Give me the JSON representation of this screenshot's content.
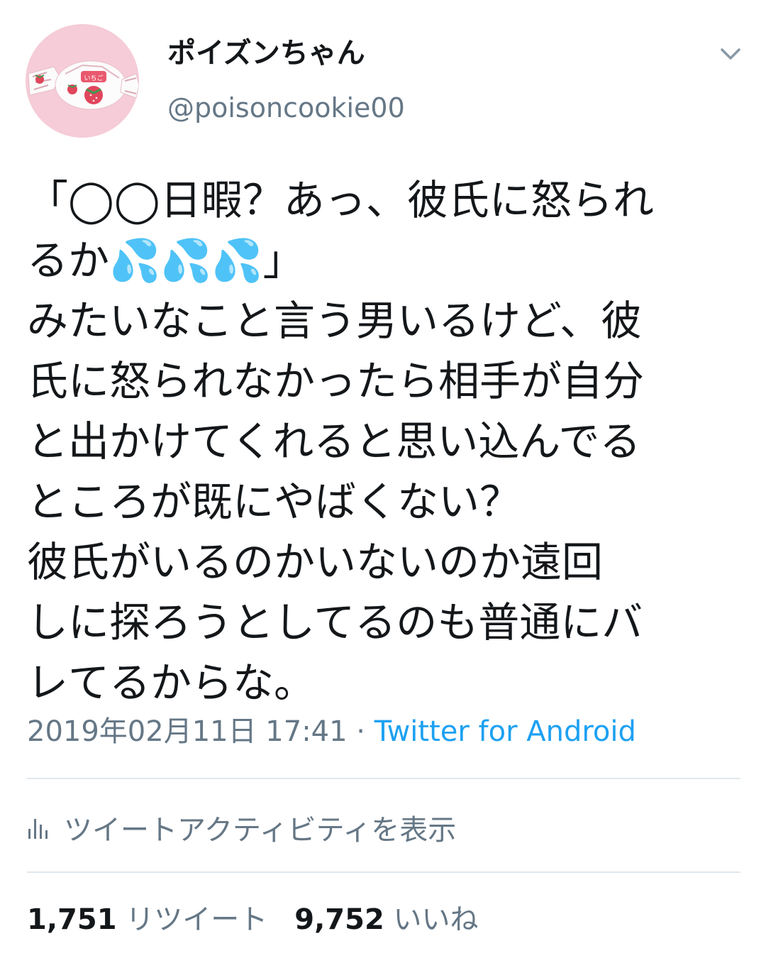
{
  "user": {
    "display_name": "ポイズンちゃん",
    "handle": "@poisoncookie00"
  },
  "tweet": {
    "lines": [
      "「◯◯日暇？あっ、彼氏に怒られ",
      "るか💦💦💦」",
      "みたいなこと言う男いるけど、彼",
      "氏に怒られなかったら相手が自分",
      "と出かけてくれると思い込んでる",
      "ところが既にやばくない？",
      "彼氏がいるのかいないのか遠回",
      "しに探ろうとしてるのも普通にバ",
      "レてるからな。"
    ]
  },
  "meta": {
    "timestamp": "2019年02月11日 17:41",
    "separator": " · ",
    "source": "Twitter for Android"
  },
  "activity": {
    "label": "ツイートアクティビティを表示"
  },
  "stats": {
    "retweet_count": "1,751",
    "retweet_label": "リツイート",
    "like_count": "9,752",
    "like_label": "いいね"
  },
  "colors": {
    "text": "#14171a",
    "secondary": "#657786",
    "link": "#1da1f2",
    "divider": "#e1e8ed",
    "avatar_bg": "#f4c6d2"
  },
  "icons": {
    "menu": "chevron-down-icon",
    "activity": "bar-chart-icon",
    "avatar": "strawberry-candy-avatar"
  }
}
